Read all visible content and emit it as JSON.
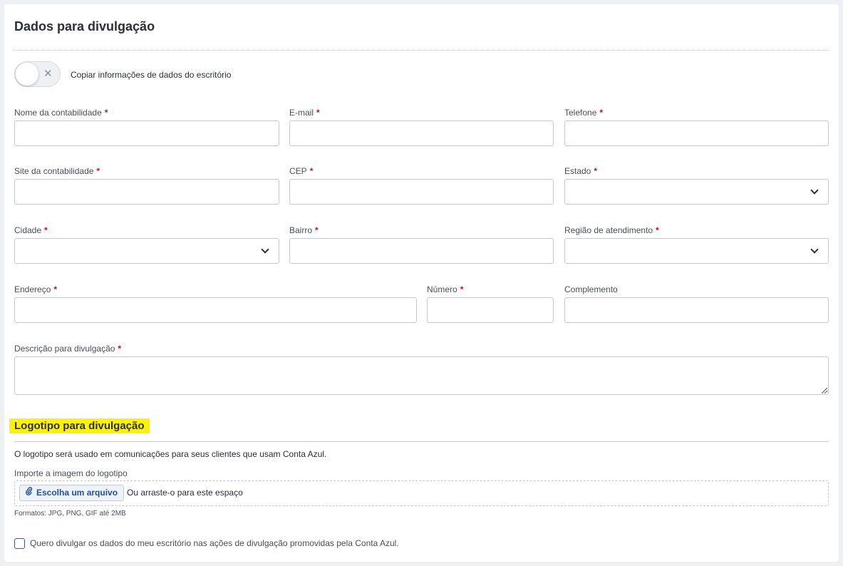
{
  "section": {
    "title": "Dados para divulgação",
    "toggle_label": "Copiar informações de dados do escritório",
    "toggle_icon": "close-icon"
  },
  "fields": {
    "nome": {
      "label": "Nome da contabilidade",
      "required": "*",
      "value": ""
    },
    "email": {
      "label": "E-mail",
      "required": "*",
      "value": ""
    },
    "telefone": {
      "label": "Telefone",
      "required": "*",
      "value": ""
    },
    "site": {
      "label": "Site da contabilidade",
      "required": "*",
      "value": ""
    },
    "cep": {
      "label": "CEP",
      "required": "*",
      "value": ""
    },
    "estado": {
      "label": "Estado",
      "required": "*",
      "value": ""
    },
    "cidade": {
      "label": "Cidade",
      "required": "*",
      "value": ""
    },
    "bairro": {
      "label": "Bairro",
      "required": "*",
      "value": ""
    },
    "regiao": {
      "label": "Região de atendimento",
      "required": "*",
      "value": ""
    },
    "endereco": {
      "label": "Endereço",
      "required": "*",
      "value": ""
    },
    "numero": {
      "label": "Número",
      "required": "*",
      "value": ""
    },
    "complemento": {
      "label": "Complemento",
      "value": ""
    },
    "descricao": {
      "label": "Descrição para divulgação",
      "required": "*",
      "value": ""
    }
  },
  "logo": {
    "title": "Logotipo para divulgação",
    "description": "O logotipo será usado em comunicações para seus clientes que usam Conta Azul.",
    "import_label": "Importe a imagem do logotipo",
    "button_label": "Escolha um arquivo",
    "drop_text": "Ou arraste-o para este espaço",
    "formats": "Formatos: JPG, PNG, GIF até 2MB"
  },
  "consent": {
    "label": "Quero divulgar os dados do meu escritório nas ações de divulgação promovidas pela Conta Azul.",
    "checked": false
  },
  "colors": {
    "highlight": "#fff200",
    "required": "#c4121b",
    "link": "#1f4f9c"
  }
}
